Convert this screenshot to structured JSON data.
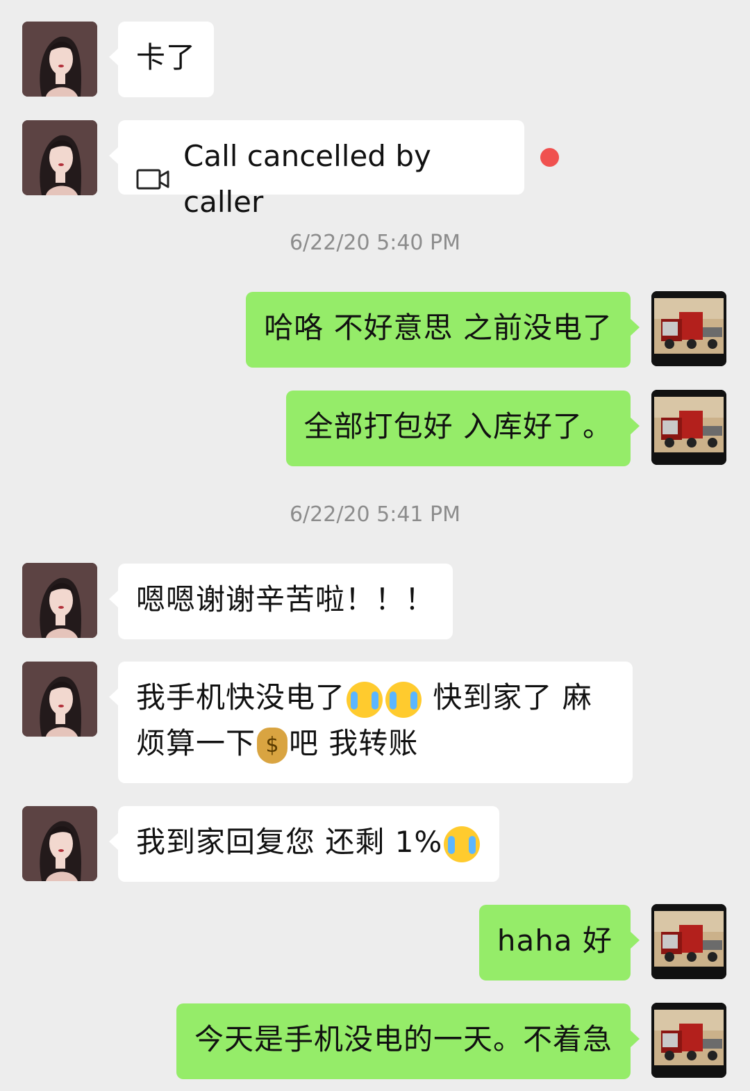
{
  "messages": [
    {
      "id": "m1",
      "side": "in",
      "text": "卡了"
    },
    {
      "id": "m2",
      "side": "in",
      "call_text": "Call cancelled by caller",
      "icon": "video-camera-icon",
      "unread": true
    },
    {
      "id": "t1",
      "timestamp": "6/22/20 5:40 PM"
    },
    {
      "id": "m3",
      "side": "out",
      "text": "哈咯 不好意思 之前没电了"
    },
    {
      "id": "m4",
      "side": "out",
      "text": "全部打包好 入库好了。"
    },
    {
      "id": "t2",
      "timestamp": "6/22/20 5:41 PM"
    },
    {
      "id": "m5",
      "side": "in",
      "text": "嗯嗯谢谢辛苦啦！！！"
    },
    {
      "id": "m6",
      "side": "in",
      "line1_a": "我手机快没电了",
      "line1_b": " 快到家了 麻",
      "line2_a": "烦算一下",
      "line2_b": "吧 我转账",
      "emojis": [
        "crying-laughing-emoji",
        "crying-laughing-emoji",
        "money-bag-emoji"
      ]
    },
    {
      "id": "m7",
      "side": "in",
      "text": "我到家回复您 还剩 1%",
      "emoji": "crying-emoji"
    },
    {
      "id": "m8",
      "side": "out",
      "text": "haha 好"
    },
    {
      "id": "m9",
      "side": "out",
      "text": "今天是手机没电的一天。不着急"
    }
  ],
  "colors": {
    "background": "#ededed",
    "incoming_bubble": "#ffffff",
    "outgoing_bubble": "#95ec69",
    "unread_dot": "#f0514f",
    "timestamp_text": "#8c8c8c"
  },
  "avatars": {
    "contact": "woman-portrait-avatar",
    "self": "red-truck-avatar"
  },
  "money_symbol": "$"
}
